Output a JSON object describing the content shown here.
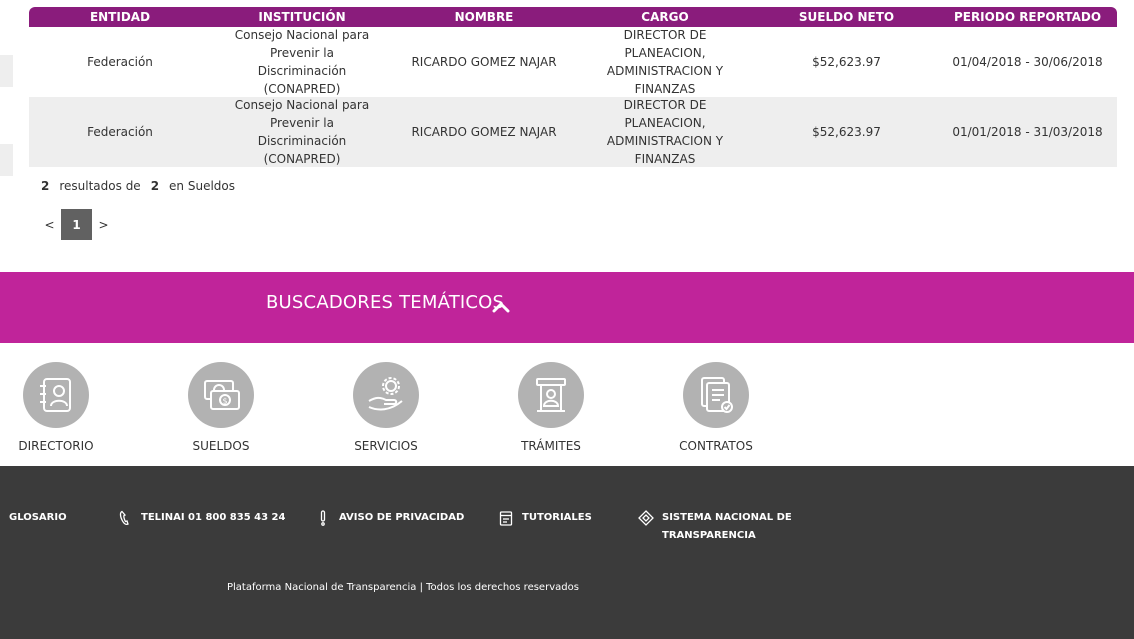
{
  "table": {
    "headers": [
      "ENTIDAD",
      "INSTITUCIÓN",
      "NOMBRE",
      "CARGO",
      "SUELDO NETO",
      "PERIODO REPORTADO"
    ],
    "rows": [
      {
        "entidad": "Federación",
        "institucion": "Consejo Nacional para Prevenir la Discriminación (CONAPRED)",
        "nombre": "RICARDO GOMEZ NAJAR",
        "cargo": "DIRECTOR DE PLANEACION, ADMINISTRACION Y FINANZAS",
        "sueldo": "$52,623.97",
        "periodo": "01/04/2018 - 30/06/2018"
      },
      {
        "entidad": "Federación",
        "institucion": "Consejo Nacional para Prevenir la Discriminación (CONAPRED)",
        "nombre": "RICARDO GOMEZ NAJAR",
        "cargo": "DIRECTOR DE PLANEACION, ADMINISTRACION Y FINANZAS",
        "sueldo": "$52,623.97",
        "periodo": "01/01/2018 - 31/03/2018"
      }
    ]
  },
  "results": {
    "count": "2",
    "text1": "resultados de",
    "total": "2",
    "text2": "en Sueldos"
  },
  "pagination": {
    "prev": "<",
    "current": "1",
    "next": ">"
  },
  "thematic": {
    "title": "BUSCADORES TEMÁTICOS",
    "tiles": [
      {
        "label": "DIRECTORIO",
        "icon": "directory-icon"
      },
      {
        "label": "SUELDOS",
        "icon": "salary-icon"
      },
      {
        "label": "SERVICIOS",
        "icon": "services-icon"
      },
      {
        "label": "TRÁMITES",
        "icon": "procedures-icon"
      },
      {
        "label": "CONTRATOS",
        "icon": "contracts-icon"
      }
    ]
  },
  "footer": {
    "glosario": "GLOSARIO",
    "telinai": "TELINAI 01 800 835 43 24",
    "aviso": "AVISO DE PRIVACIDAD",
    "tutoriales": "TUTORIALES",
    "sistema_line1": "SISTEMA NACIONAL DE",
    "sistema_line2": "TRANSPARENCIA",
    "copyright": "Plataforma Nacional de Transparencia | Todos los derechos reservados"
  },
  "colors": {
    "header_purple": "#8a1c7c",
    "band_magenta": "#c0249a",
    "footer_dark": "#3b3b3b",
    "tile_gray": "#b2b2b2",
    "pager_active": "#616161"
  }
}
